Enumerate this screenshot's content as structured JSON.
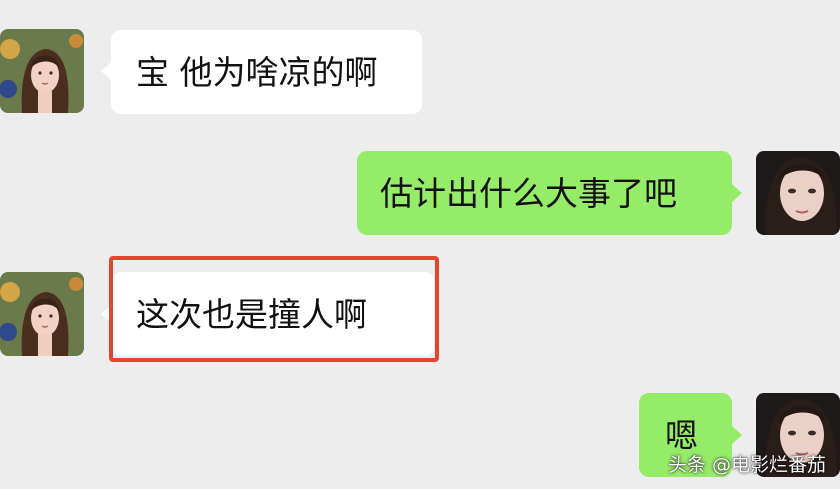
{
  "messages": [
    {
      "side": "left",
      "text": "宝 他为啥凉的啊"
    },
    {
      "side": "right",
      "text": "估计出什么大事了吧"
    },
    {
      "side": "left",
      "text": "这次也是撞人啊",
      "highlighted": true
    },
    {
      "side": "right",
      "text": "嗯"
    }
  ],
  "watermark": "头条 @电影烂番茄",
  "colors": {
    "background": "#ededed",
    "left_bubble": "#ffffff",
    "right_bubble": "#95ec69",
    "highlight_border": "#e5442e"
  }
}
